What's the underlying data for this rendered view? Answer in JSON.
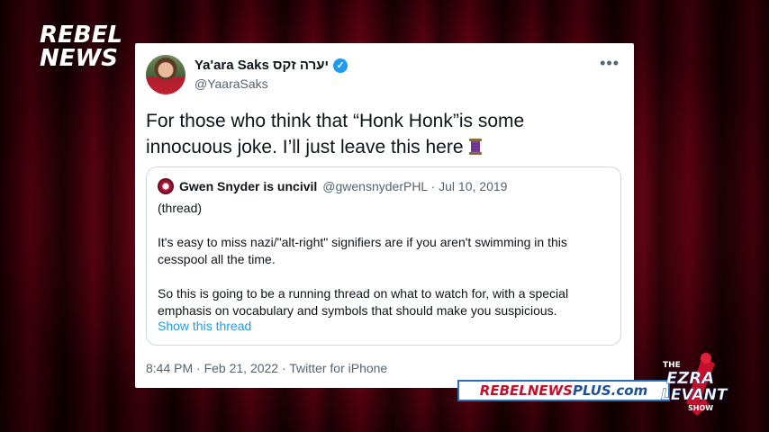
{
  "brand": {
    "line1": "REBEL",
    "line2": "NEWS"
  },
  "tweet": {
    "author_name": "Ya'ara Saks יערה זקס",
    "author_handle": "@YaaraSaks",
    "more_label": "•••",
    "body_line1": "For those who think that “Honk Honk”is some",
    "body_line2": "innocuous joke. I’ll just leave this here",
    "quoted": {
      "author_name": "Gwen Snyder is uncivil",
      "author_meta": "@gwensnyderPHL · Jul 10, 2019",
      "paragraphs": [
        "(thread)",
        "It's easy to miss nazi/\"alt-right\" signifiers are if you aren't swimming in this cesspool all the time.",
        "So this is going to be a running thread on what to watch for, with a special emphasis on vocabulary and symbols that should make you suspicious."
      ],
      "show_thread": "Show this thread"
    },
    "footer": "8:44 PM · Feb 21, 2022 · Twitter for iPhone"
  },
  "overlay": {
    "plus_part1": "REBELNEWS",
    "plus_part2": "PLUS.com",
    "show_the": "THE",
    "show_ezra": "EZRA",
    "show_levant": "LEVANT",
    "show_show": "SHOW"
  },
  "colors": {
    "accent_blue": "#1d9bf0",
    "brand_red": "#c4102b",
    "brand_blue": "#1d4f9a"
  },
  "icons": [
    "verified-badge-icon",
    "more-icon",
    "thread-spool-icon"
  ]
}
